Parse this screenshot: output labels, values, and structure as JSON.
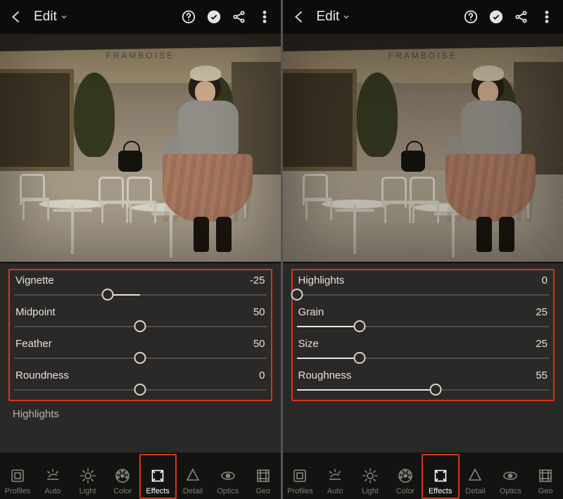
{
  "header": {
    "title": "Edit"
  },
  "photo": {
    "sign_text": "FRAMBOISE"
  },
  "left": {
    "sliders": [
      {
        "label": "Vignette",
        "value": "-25",
        "thumb_pct": 37,
        "fill_from": 37,
        "fill_to": 50
      },
      {
        "label": "Midpoint",
        "value": "50",
        "thumb_pct": 50,
        "fill_from": 50,
        "fill_to": 50
      },
      {
        "label": "Feather",
        "value": "50",
        "thumb_pct": 50,
        "fill_from": 50,
        "fill_to": 50
      },
      {
        "label": "Roundness",
        "value": "0",
        "thumb_pct": 50,
        "fill_from": 50,
        "fill_to": 50
      }
    ],
    "below_label": "Highlights"
  },
  "right": {
    "sliders": [
      {
        "label": "Highlights",
        "value": "0",
        "thumb_pct": 0,
        "fill_from": 0,
        "fill_to": 0
      },
      {
        "label": "Grain",
        "value": "25",
        "thumb_pct": 25,
        "fill_from": 0,
        "fill_to": 25
      },
      {
        "label": "Size",
        "value": "25",
        "thumb_pct": 25,
        "fill_from": 0,
        "fill_to": 25
      },
      {
        "label": "Roughness",
        "value": "55",
        "thumb_pct": 55,
        "fill_from": 0,
        "fill_to": 55
      }
    ]
  },
  "nav": {
    "items": [
      {
        "label": "Profiles",
        "active": false
      },
      {
        "label": "Auto",
        "active": false
      },
      {
        "label": "Light",
        "active": false
      },
      {
        "label": "Color",
        "active": false
      },
      {
        "label": "Effects",
        "active": true
      },
      {
        "label": "Detail",
        "active": false
      },
      {
        "label": "Optics",
        "active": false
      },
      {
        "label": "Geo",
        "active": false
      }
    ]
  }
}
